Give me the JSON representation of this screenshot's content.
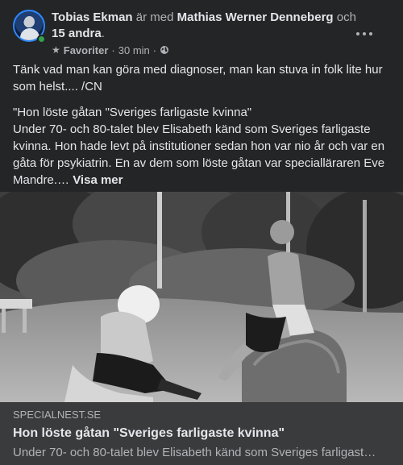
{
  "post": {
    "author": "Tobias Ekman",
    "with_text": " är med ",
    "tagged_person": "Mathias Werner Denneberg",
    "and_text": " och ",
    "others": "15 andra",
    "period": ".",
    "audience_label": "Favoriter",
    "time": "30 min",
    "meta_sep": "·",
    "icons": {
      "more": "more-horizontal-icon",
      "star": "star-icon",
      "privacy": "globe-icon",
      "online": "online-status-dot"
    },
    "paragraph1": "Tänk vad man kan göra med diagnoser, man kan stuva in folk lite hur som helst.... /CN",
    "paragraph2_line1": "\"Hon löste gåtan \"Sveriges farligaste kvinna\"",
    "paragraph2_line2": "Under 70- och 80-talet blev Elisabeth känd som Sveriges farligaste kvinna. Hon hade levt på institutioner sedan hon var nio år och var en gåta för psykiatrin. En av dem som löste gåtan var specialläraren Eve Mandre.…",
    "see_more": "Visa mer"
  },
  "link_preview": {
    "domain": "SPECIALNEST.SE",
    "title": "Hon löste gåtan \"Sveriges farligaste kvinna\"",
    "description": "Under 70- och 80-talet blev Elisabeth känd som Sveriges farligast…"
  },
  "colors": {
    "background": "#242526",
    "link_bar": "#3a3b3c",
    "primary_text": "#e4e6eb",
    "secondary_text": "#b0b3b8",
    "online": "#31a24c"
  }
}
